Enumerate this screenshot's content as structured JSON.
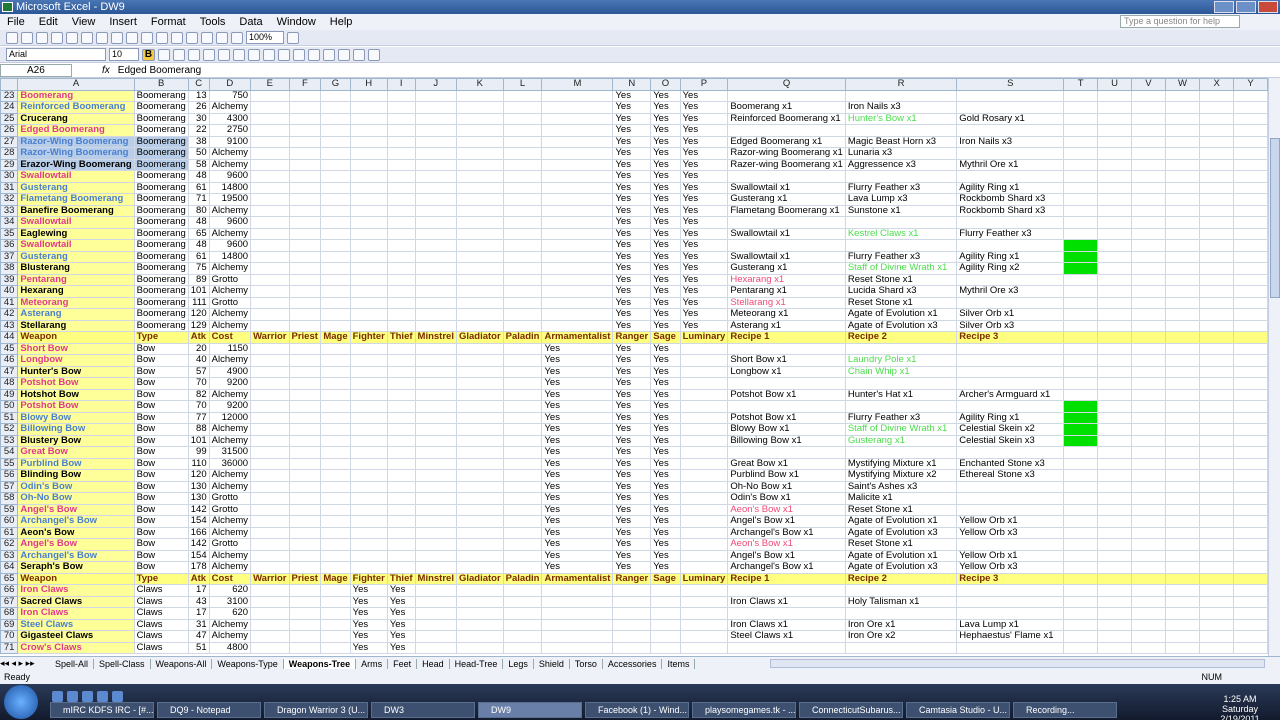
{
  "window": {
    "title": "Microsoft Excel - DW9"
  },
  "menu": [
    "File",
    "Edit",
    "View",
    "Insert",
    "Format",
    "Tools",
    "Data",
    "Window",
    "Help"
  ],
  "help_placeholder": "Type a question for help",
  "toolbar": {
    "zoom": "100%",
    "font": "Arial",
    "size": "10"
  },
  "formula": {
    "name_box": "A26",
    "fx": "fx",
    "content": "Edged Boomerang"
  },
  "columns": [
    "A",
    "B",
    "C",
    "D",
    "E",
    "F",
    "G",
    "H",
    "I",
    "J",
    "K",
    "L",
    "M",
    "N",
    "O",
    "P",
    "Q",
    "R",
    "S",
    "T",
    "U",
    "V",
    "W",
    "X",
    "Y"
  ],
  "rows": [
    {
      "n": "23",
      "a": "Boomerang",
      "b": "Boomerang",
      "c": "13",
      "d": "750",
      "n2": "Yes",
      "o": "Yes",
      "p": "Yes",
      "q": "",
      "r": "",
      "s": "",
      "cls": "red"
    },
    {
      "n": "24",
      "a": "Reinforced Boomerang",
      "b": "Boomerang",
      "c": "26",
      "d": "Alchemy",
      "n2": "Yes",
      "o": "Yes",
      "p": "Yes",
      "q": "Boomerang x1",
      "r": "Iron Nails x3",
      "s": "",
      "cls": "blue"
    },
    {
      "n": "25",
      "a": "Crucerang",
      "b": "Boomerang",
      "c": "30",
      "d": "4300",
      "n2": "Yes",
      "o": "Yes",
      "p": "Yes",
      "q": "Reinforced Boomerang x1",
      "r": "Hunter's Bow x1",
      "s": "Gold Rosary x1",
      "cls": "blk",
      "rg": 1
    },
    {
      "n": "26",
      "a": "Edged Boomerang",
      "b": "Boomerang",
      "c": "22",
      "d": "2750",
      "n2": "Yes",
      "o": "Yes",
      "p": "Yes",
      "q": "",
      "r": "",
      "s": "",
      "cls": "red"
    },
    {
      "n": "27",
      "a": "Razor-Wing Boomerang",
      "b": "Boomerang",
      "c": "38",
      "d": "9100",
      "n2": "Yes",
      "o": "Yes",
      "p": "Yes",
      "q": "Edged Boomerang x1",
      "r": "Magic Beast Horn x3",
      "s": "Iron Nails x3",
      "cls": "blue",
      "sel": 1
    },
    {
      "n": "28",
      "a": "Razor-Wing Boomerang",
      "b": "Boomerang",
      "c": "50",
      "d": "Alchemy",
      "n2": "Yes",
      "o": "Yes",
      "p": "Yes",
      "q": "Razor-wing Boomerang x1",
      "r": "Lunaria x3",
      "s": "",
      "cls": "blue",
      "sel": 1
    },
    {
      "n": "29",
      "a": "Erazor-Wing Boomerang",
      "b": "Boomerang",
      "c": "58",
      "d": "Alchemy",
      "n2": "Yes",
      "o": "Yes",
      "p": "Yes",
      "q": "Razer-wing Boomerang x1",
      "r": "Aggressence x3",
      "s": "Mythril Ore x1",
      "cls": "blk",
      "sel": 1
    },
    {
      "n": "30",
      "a": "Swallowtail",
      "b": "Boomerang",
      "c": "48",
      "d": "9600",
      "n2": "Yes",
      "o": "Yes",
      "p": "Yes",
      "q": "",
      "r": "",
      "s": "",
      "cls": "red"
    },
    {
      "n": "31",
      "a": "Gusterang",
      "b": "Boomerang",
      "c": "61",
      "d": "14800",
      "n2": "Yes",
      "o": "Yes",
      "p": "Yes",
      "q": "Swallowtail x1",
      "r": "Flurry Feather x3",
      "s": "Agility Ring x1",
      "cls": "blue"
    },
    {
      "n": "32",
      "a": "Flametang Boomerang",
      "b": "Boomerang",
      "c": "71",
      "d": "19500",
      "n2": "Yes",
      "o": "Yes",
      "p": "Yes",
      "q": "Gusterang x1",
      "r": "Lava Lump x3",
      "s": "Rockbomb Shard x3",
      "cls": "blue"
    },
    {
      "n": "33",
      "a": "Banefire Boomerang",
      "b": "Boomerang",
      "c": "80",
      "d": "Alchemy",
      "n2": "Yes",
      "o": "Yes",
      "p": "Yes",
      "q": "Flametang Boomerang x1",
      "r": "Sunstone x1",
      "s": "Rockbomb Shard x3",
      "cls": "blk"
    },
    {
      "n": "34",
      "a": "Swallowtail",
      "b": "Boomerang",
      "c": "48",
      "d": "9600",
      "n2": "Yes",
      "o": "Yes",
      "p": "Yes",
      "q": "",
      "r": "",
      "s": "",
      "cls": "red"
    },
    {
      "n": "35",
      "a": "Eaglewing",
      "b": "Boomerang",
      "c": "65",
      "d": "Alchemy",
      "n2": "Yes",
      "o": "Yes",
      "p": "Yes",
      "q": "Swallowtail x1",
      "r": "Kestrel Claws x1",
      "s": "Flurry Feather x3",
      "cls": "blk",
      "rg": 1
    },
    {
      "n": "36",
      "a": "Swallowtail",
      "b": "Boomerang",
      "c": "48",
      "d": "9600",
      "n2": "Yes",
      "o": "Yes",
      "p": "Yes",
      "q": "",
      "r": "",
      "s": "",
      "cls": "red",
      "g": 1
    },
    {
      "n": "37",
      "a": "Gusterang",
      "b": "Boomerang",
      "c": "61",
      "d": "14800",
      "n2": "Yes",
      "o": "Yes",
      "p": "Yes",
      "q": "Swallowtail x1",
      "r": "Flurry Feather x3",
      "s": "Agility Ring x1",
      "cls": "blue",
      "g": 1
    },
    {
      "n": "38",
      "a": "Blusterang",
      "b": "Boomerang",
      "c": "75",
      "d": "Alchemy",
      "n2": "Yes",
      "o": "Yes",
      "p": "Yes",
      "q": "Gusterang x1",
      "r": "Staff of Divine Wrath x1",
      "s": "Agility Ring x2",
      "cls": "blk",
      "rg": 1,
      "g": 1
    },
    {
      "n": "39",
      "a": "Pentarang",
      "b": "Boomerang",
      "c": "89",
      "d": "Grotto",
      "n2": "Yes",
      "o": "Yes",
      "p": "Yes",
      "q": "Hexarang x1",
      "r": "Reset Stone x1",
      "s": "",
      "cls": "red",
      "qp": 1
    },
    {
      "n": "40",
      "a": "Hexarang",
      "b": "Boomerang",
      "c": "101",
      "d": "Alchemy",
      "n2": "Yes",
      "o": "Yes",
      "p": "Yes",
      "q": "Pentarang x1",
      "r": "Lucida Shard x3",
      "s": "Mythril Ore x3",
      "cls": "blk"
    },
    {
      "n": "41",
      "a": "Meteorang",
      "b": "Boomerang",
      "c": "111",
      "d": "Grotto",
      "n2": "Yes",
      "o": "Yes",
      "p": "Yes",
      "q": "Stellarang x1",
      "r": "Reset Stone x1",
      "s": "",
      "cls": "red",
      "qp": 1
    },
    {
      "n": "42",
      "a": "Asterang",
      "b": "Boomerang",
      "c": "120",
      "d": "Alchemy",
      "n2": "Yes",
      "o": "Yes",
      "p": "Yes",
      "q": "Meteorang x1",
      "r": "Agate of Evolution x1",
      "s": "Silver Orb x1",
      "cls": "blue"
    },
    {
      "n": "43",
      "a": "Stellarang",
      "b": "Boomerang",
      "c": "129",
      "d": "Alchemy",
      "n2": "Yes",
      "o": "Yes",
      "p": "Yes",
      "q": "Asterang x1",
      "r": "Agate of Evolution x3",
      "s": "Silver Orb x3",
      "cls": "blk"
    }
  ],
  "header_row": {
    "n": "44",
    "cells": [
      "Weapon",
      "Type",
      "Atk",
      "Cost",
      "Warrior",
      "Priest",
      "Mage",
      "Fighter",
      "Thief",
      "Minstrel",
      "Gladiator",
      "Paladin",
      "Armamentalist",
      "Ranger",
      "Sage",
      "Luminary",
      "Recipe 1",
      "Recipe 2",
      "Recipe 3"
    ]
  },
  "bows": [
    {
      "n": "45",
      "a": "Short Bow",
      "b": "Bow",
      "c": "20",
      "d": "1150",
      "m": "Yes",
      "n2": "Yes",
      "o": "Yes",
      "q": "",
      "r": "",
      "s": "",
      "cls": "red"
    },
    {
      "n": "46",
      "a": "Longbow",
      "b": "Bow",
      "c": "40",
      "d": "Alchemy",
      "m": "Yes",
      "n2": "Yes",
      "o": "Yes",
      "q": "Short Bow x1",
      "r": "Laundry Pole x1",
      "s": "",
      "cls": "red",
      "rg": 1
    },
    {
      "n": "47",
      "a": "Hunter's Bow",
      "b": "Bow",
      "c": "57",
      "d": "4900",
      "m": "Yes",
      "n2": "Yes",
      "o": "Yes",
      "q": "Longbow x1",
      "r": "Chain Whip x1",
      "s": "",
      "cls": "blk",
      "rg": 1
    },
    {
      "n": "48",
      "a": "Potshot Bow",
      "b": "Bow",
      "c": "70",
      "d": "9200",
      "m": "Yes",
      "n2": "Yes",
      "o": "Yes",
      "q": "",
      "r": "",
      "s": "",
      "cls": "red"
    },
    {
      "n": "49",
      "a": "Hotshot Bow",
      "b": "Bow",
      "c": "82",
      "d": "Alchemy",
      "m": "Yes",
      "n2": "Yes",
      "o": "Yes",
      "q": "Potshot Bow x1",
      "r": "Hunter's Hat x1",
      "s": "Archer's Armguard x1",
      "cls": "blk"
    },
    {
      "n": "50",
      "a": "Potshot Bow",
      "b": "Bow",
      "c": "70",
      "d": "9200",
      "m": "Yes",
      "n2": "Yes",
      "o": "Yes",
      "q": "",
      "r": "",
      "s": "",
      "cls": "red",
      "g": 1
    },
    {
      "n": "51",
      "a": "Blowy Bow",
      "b": "Bow",
      "c": "77",
      "d": "12000",
      "m": "Yes",
      "n2": "Yes",
      "o": "Yes",
      "q": "Potshot Bow x1",
      "r": "Flurry Feather x3",
      "s": "Agility Ring x1",
      "cls": "blue",
      "g": 1
    },
    {
      "n": "52",
      "a": "Billowing Bow",
      "b": "Bow",
      "c": "88",
      "d": "Alchemy",
      "m": "Yes",
      "n2": "Yes",
      "o": "Yes",
      "q": "Blowy Bow x1",
      "r": "Staff of Divine Wrath x1",
      "s": "Celestial Skein x2",
      "cls": "blue",
      "rg": 1,
      "g": 1
    },
    {
      "n": "53",
      "a": "Blustery Bow",
      "b": "Bow",
      "c": "101",
      "d": "Alchemy",
      "m": "Yes",
      "n2": "Yes",
      "o": "Yes",
      "q": "Billowing Bow x1",
      "r": "Gusterang x1",
      "s": "Celestial Skein x3",
      "cls": "blk",
      "rg": 1,
      "g": 1
    },
    {
      "n": "54",
      "a": "Great Bow",
      "b": "Bow",
      "c": "99",
      "d": "31500",
      "m": "Yes",
      "n2": "Yes",
      "o": "Yes",
      "q": "",
      "r": "",
      "s": "",
      "cls": "red"
    },
    {
      "n": "55",
      "a": "Purblind Bow",
      "b": "Bow",
      "c": "110",
      "d": "36000",
      "m": "Yes",
      "n2": "Yes",
      "o": "Yes",
      "q": "Great Bow x1",
      "r": "Mystifying Mixture x1",
      "s": "Enchanted Stone x3",
      "cls": "blue"
    },
    {
      "n": "56",
      "a": "Blinding Bow",
      "b": "Bow",
      "c": "120",
      "d": "Alchemy",
      "m": "Yes",
      "n2": "Yes",
      "o": "Yes",
      "q": "Purblind Bow x1",
      "r": "Mystifying Mixture x2",
      "s": "Ethereal Stone x3",
      "cls": "blk"
    },
    {
      "n": "57",
      "a": "Odin's Bow",
      "b": "Bow",
      "c": "130",
      "d": "Alchemy",
      "m": "Yes",
      "n2": "Yes",
      "o": "Yes",
      "q": "Oh-No Bow x1",
      "r": "Saint's Ashes x3",
      "s": "",
      "cls": "blue"
    },
    {
      "n": "58",
      "a": "Oh-No Bow",
      "b": "Bow",
      "c": "130",
      "d": "Grotto",
      "m": "Yes",
      "n2": "Yes",
      "o": "Yes",
      "q": "Odin's Bow x1",
      "r": "Malicite x1",
      "s": "",
      "cls": "blue"
    },
    {
      "n": "59",
      "a": "Angel's Bow",
      "b": "Bow",
      "c": "142",
      "d": "Grotto",
      "m": "Yes",
      "n2": "Yes",
      "o": "Yes",
      "q": "Aeon's Bow x1",
      "r": "Reset Stone x1",
      "s": "",
      "cls": "red",
      "qp": 1
    },
    {
      "n": "60",
      "a": "Archangel's Bow",
      "b": "Bow",
      "c": "154",
      "d": "Alchemy",
      "m": "Yes",
      "n2": "Yes",
      "o": "Yes",
      "q": "Angel's Bow x1",
      "r": "Agate of Evolution x1",
      "s": "Yellow Orb x1",
      "cls": "blue"
    },
    {
      "n": "61",
      "a": "Aeon's Bow",
      "b": "Bow",
      "c": "166",
      "d": "Alchemy",
      "m": "Yes",
      "n2": "Yes",
      "o": "Yes",
      "q": "Archangel's Bow x1",
      "r": "Agate of Evolution x3",
      "s": "Yellow Orb x3",
      "cls": "blk"
    },
    {
      "n": "62",
      "a": "Angel's Bow",
      "b": "Bow",
      "c": "142",
      "d": "Grotto",
      "m": "Yes",
      "n2": "Yes",
      "o": "Yes",
      "q": "Aeon's Bow x1",
      "r": "Reset Stone x1",
      "s": "",
      "cls": "red",
      "qp": 1
    },
    {
      "n": "63",
      "a": "Archangel's Bow",
      "b": "Bow",
      "c": "154",
      "d": "Alchemy",
      "m": "Yes",
      "n2": "Yes",
      "o": "Yes",
      "q": "Angel's Bow x1",
      "r": "Agate of Evolution x1",
      "s": "Yellow Orb x1",
      "cls": "blue"
    },
    {
      "n": "64",
      "a": "Seraph's Bow",
      "b": "Bow",
      "c": "178",
      "d": "Alchemy",
      "m": "Yes",
      "n2": "Yes",
      "o": "Yes",
      "q": "Archangel's Bow x1",
      "r": "Agate of Evolution x3",
      "s": "Yellow Orb x3",
      "cls": "blk"
    }
  ],
  "header_row2": {
    "n": "65"
  },
  "claws": [
    {
      "n": "66",
      "a": "Iron Claws",
      "b": "Claws",
      "c": "17",
      "d": "620",
      "h": "Yes",
      "i": "Yes",
      "q": "",
      "r": "",
      "s": "",
      "cls": "red"
    },
    {
      "n": "67",
      "a": "Sacred Claws",
      "b": "Claws",
      "c": "43",
      "d": "3100",
      "h": "Yes",
      "i": "Yes",
      "q": "Iron Claws x1",
      "r": "Holy Talisman x1",
      "s": "",
      "cls": "blk"
    },
    {
      "n": "68",
      "a": "Iron Claws",
      "b": "Claws",
      "c": "17",
      "d": "620",
      "h": "Yes",
      "i": "Yes",
      "q": "",
      "r": "",
      "s": "",
      "cls": "red"
    },
    {
      "n": "69",
      "a": "Steel Claws",
      "b": "Claws",
      "c": "31",
      "d": "Alchemy",
      "h": "Yes",
      "i": "Yes",
      "q": "Iron Claws x1",
      "r": "Iron Ore x1",
      "s": "Lava Lump x1",
      "cls": "blue"
    },
    {
      "n": "70",
      "a": "Gigasteel Claws",
      "b": "Claws",
      "c": "47",
      "d": "Alchemy",
      "h": "Yes",
      "i": "Yes",
      "q": "Steel Claws x1",
      "r": "Iron Ore x2",
      "s": "Hephaestus' Flame x1",
      "cls": "blk"
    },
    {
      "n": "71",
      "a": "Crow's Claws",
      "b": "Claws",
      "c": "51",
      "d": "4800",
      "h": "Yes",
      "i": "Yes",
      "q": "",
      "r": "",
      "s": "",
      "cls": "red"
    }
  ],
  "sheet_tabs": [
    "Spell-All",
    "Spell-Class",
    "Weapons-All",
    "Weapons-Type",
    "Weapons-Tree",
    "Arms",
    "Feet",
    "Head",
    "Head-Tree",
    "Legs",
    "Shield",
    "Torso",
    "Accessories",
    "Items"
  ],
  "active_tab": "Weapons-Tree",
  "status": {
    "left": "Ready",
    "num": "NUM"
  },
  "taskbar": {
    "tasks": [
      "mIRC KDFS IRC - [#...",
      "DQ9 - Notepad",
      "Dragon Warrior 3 (U...",
      "DW3",
      "DW9",
      "Facebook (1) - Wind...",
      "playsomegames.tk - ...",
      "ConnecticutSubarus...",
      "Camtasia Studio - U...",
      "Recording..."
    ],
    "time": "1:25 AM",
    "day": "Saturday",
    "date": "2/19/2011"
  }
}
